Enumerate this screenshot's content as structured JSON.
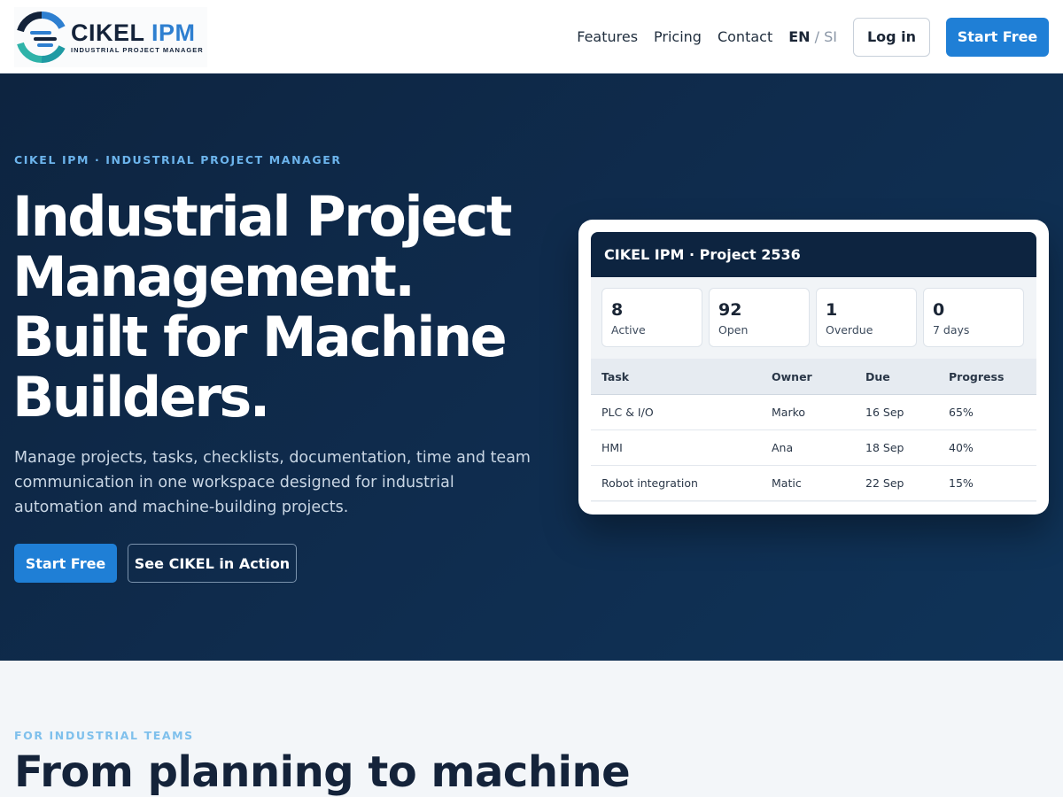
{
  "brand": {
    "name_main": "CIKEL",
    "name_accent": "IPM",
    "tagline": "INDUSTRIAL PROJECT MANAGER"
  },
  "nav": {
    "links": [
      "Features",
      "Pricing",
      "Contact"
    ],
    "lang_active": "EN",
    "lang_sep": "/",
    "lang_other": "SI",
    "login_label": "Log in",
    "start_label": "Start Free"
  },
  "hero": {
    "eyebrow": "CIKEL IPM · INDUSTRIAL PROJECT MANAGER",
    "title_lines": [
      "Industrial Project",
      "Management.",
      "Built for Machine",
      "Builders."
    ],
    "description": "Manage projects, tasks, checklists, documentation, time and team communication in one workspace designed for industrial automation and machine-building projects.",
    "primary_cta": "Start Free",
    "secondary_cta": "See CIKEL in Action"
  },
  "card": {
    "title": "CIKEL IPM · Project 2536",
    "stats": [
      {
        "value": "8",
        "label": "Active"
      },
      {
        "value": "92",
        "label": "Open"
      },
      {
        "value": "1",
        "label": "Overdue"
      },
      {
        "value": "0",
        "label": "7 days"
      }
    ],
    "columns": [
      "Task",
      "Owner",
      "Due",
      "Progress"
    ],
    "rows": [
      [
        "PLC & I/O",
        "Marko",
        "16 Sep",
        "65%"
      ],
      [
        "HMI",
        "Ana",
        "18 Sep",
        "40%"
      ],
      [
        "Robot integration",
        "Matic",
        "22 Sep",
        "15%"
      ]
    ]
  },
  "section": {
    "eyebrow": "FOR INDUSTRIAL TEAMS",
    "title": "From planning to machine"
  },
  "colors": {
    "accent": "#1f7fd6",
    "hero_bg": "#0f2b4c",
    "eyebrow": "#6cb4ec"
  }
}
